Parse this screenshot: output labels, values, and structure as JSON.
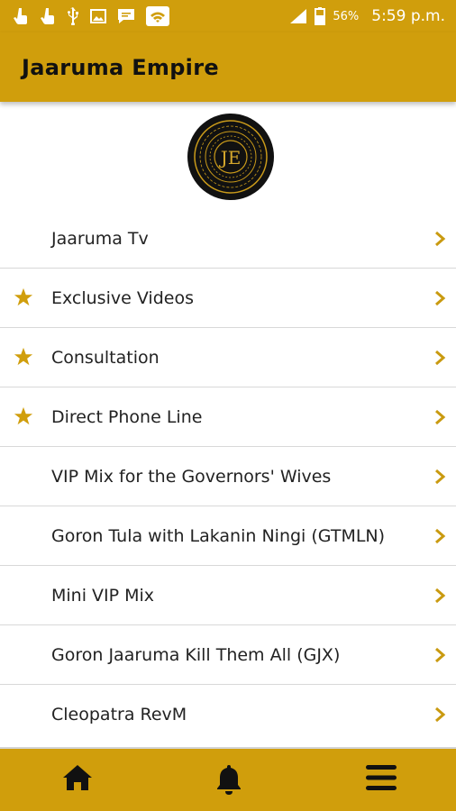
{
  "status_bar": {
    "battery": "56%",
    "time": "5:59 p.m."
  },
  "app_bar": {
    "title": "Jaaruma Empire"
  },
  "logo": {
    "monogram": "JE"
  },
  "menu": {
    "items": [
      {
        "label": "Jaaruma Tv",
        "starred": false
      },
      {
        "label": "Exclusive Videos",
        "starred": true
      },
      {
        "label": "Consultation",
        "starred": true
      },
      {
        "label": "Direct Phone Line",
        "starred": true
      },
      {
        "label": "VIP Mix for the Governors' Wives",
        "starred": false
      },
      {
        "label": "Goron Tula with Lakanin Ningi (GTMLN)",
        "starred": false
      },
      {
        "label": "Mini VIP Mix",
        "starred": false
      },
      {
        "label": "Goron Jaaruma Kill Them All (GJX)",
        "starred": false
      },
      {
        "label": "Cleopatra RevM",
        "starred": false
      }
    ]
  },
  "bottom_nav": {
    "icons": [
      "home-icon",
      "bell-icon",
      "menu-icon"
    ]
  },
  "colors": {
    "accent": "#d09e0c",
    "text": "#222222",
    "divider": "#d8d8d8"
  }
}
